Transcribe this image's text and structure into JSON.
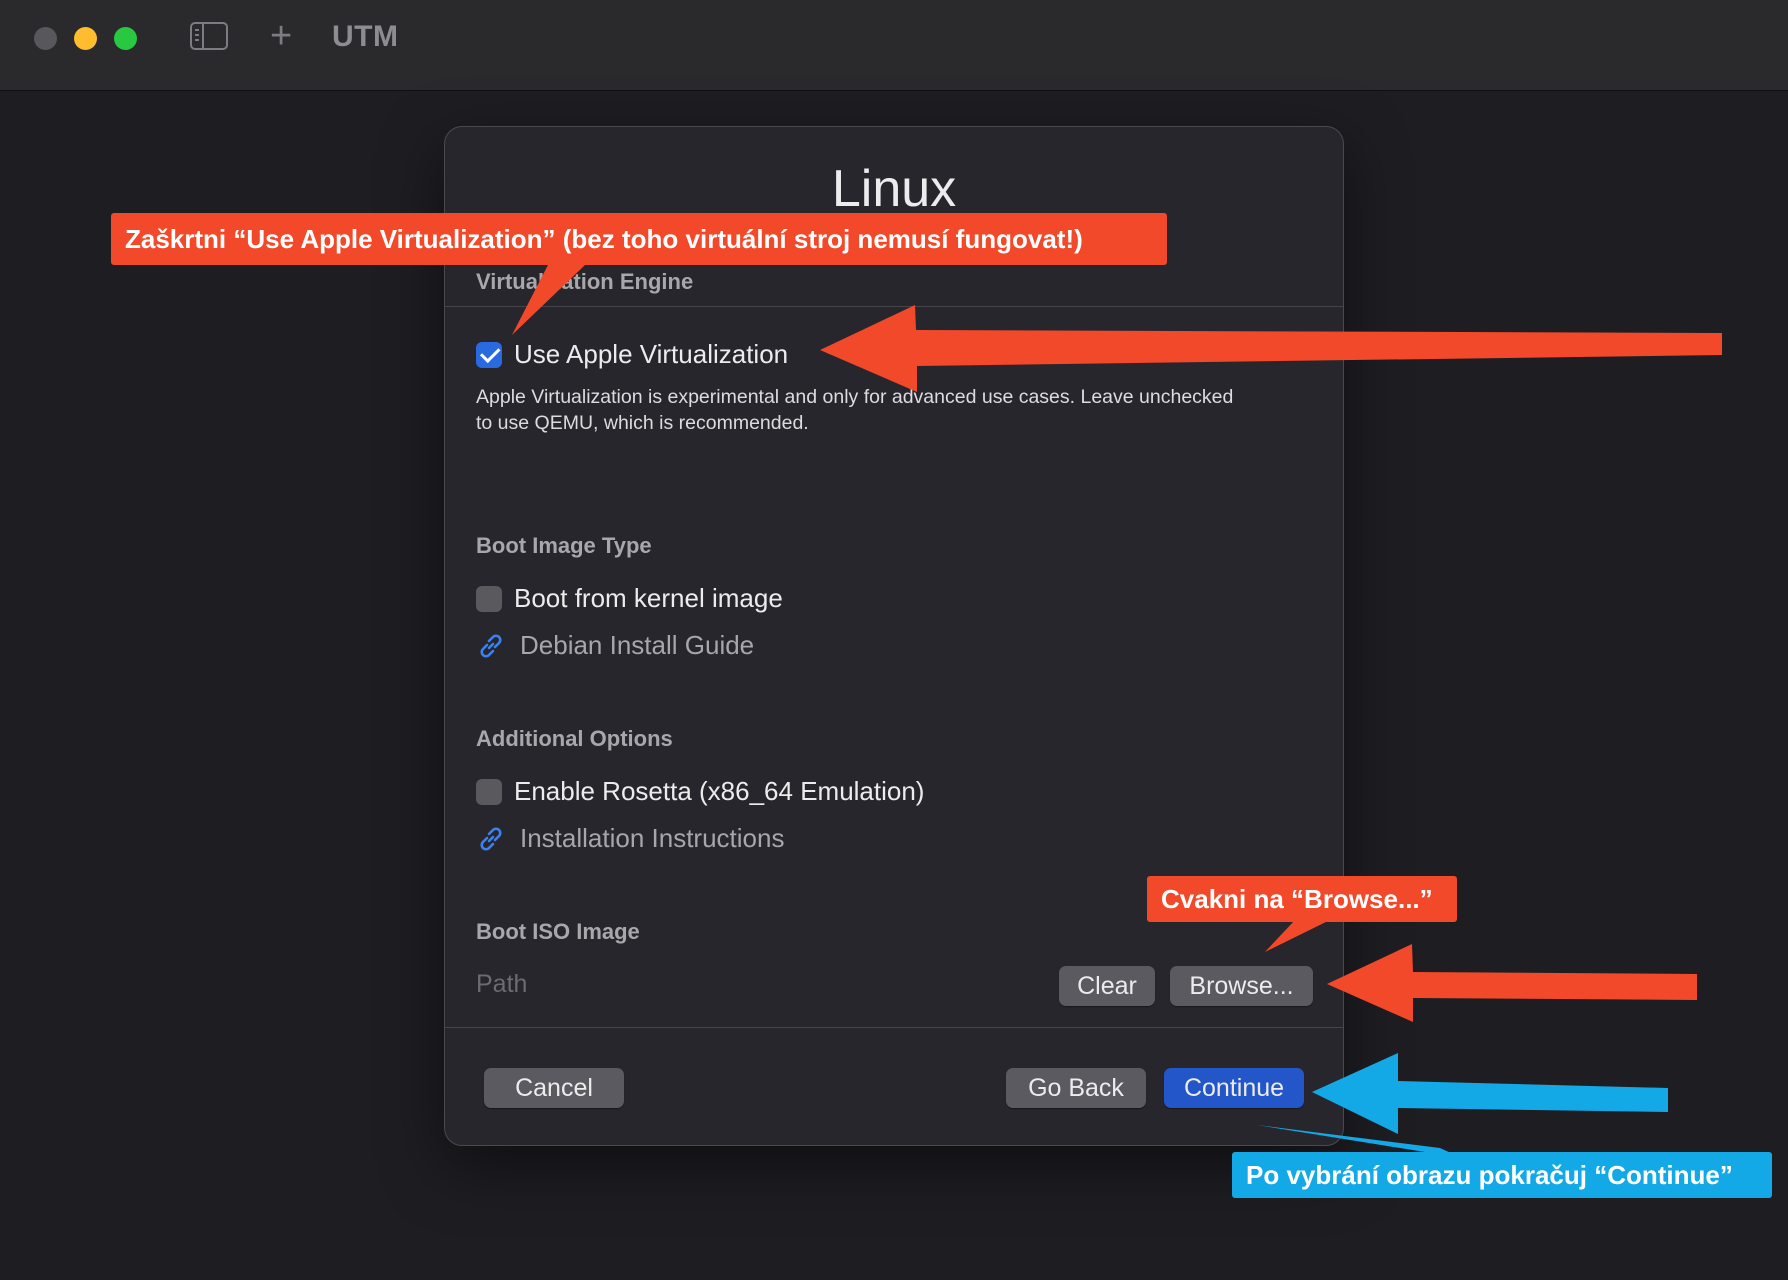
{
  "window": {
    "app_title": "UTM",
    "icons": [
      "sidebar-toggle-icon",
      "plus-icon"
    ]
  },
  "dialog": {
    "title": "Linux",
    "virtualization": {
      "section_label": "Virtualization Engine",
      "checkbox_label": "Use Apple Virtualization",
      "checked": true,
      "description": "Apple Virtualization is experimental and only for advanced use cases. Leave unchecked to use QEMU, which is recommended."
    },
    "boot_image_type": {
      "section_label": "Boot Image Type",
      "checkbox_label": "Boot from kernel image",
      "checked": false,
      "link_label": "Debian Install Guide"
    },
    "additional_options": {
      "section_label": "Additional Options",
      "checkbox_label": "Enable Rosetta (x86_64 Emulation)",
      "checked": false,
      "link_label": "Installation Instructions"
    },
    "boot_iso": {
      "section_label": "Boot ISO Image",
      "path_placeholder": "Path",
      "clear_label": "Clear",
      "browse_label": "Browse..."
    },
    "footer": {
      "cancel_label": "Cancel",
      "go_back_label": "Go Back",
      "continue_label": "Continue"
    }
  },
  "annotations": {
    "top": "Zaškrtni “Use Apple Virtualization” (bez toho virtuální stroj nemusí fungovat!)",
    "browse": "Cvakni na “Browse...”",
    "continue": "Po vybrání obrazu pokračuj “Continue”",
    "colors": {
      "red": "#f2492a",
      "blue": "#13a9e6"
    }
  }
}
